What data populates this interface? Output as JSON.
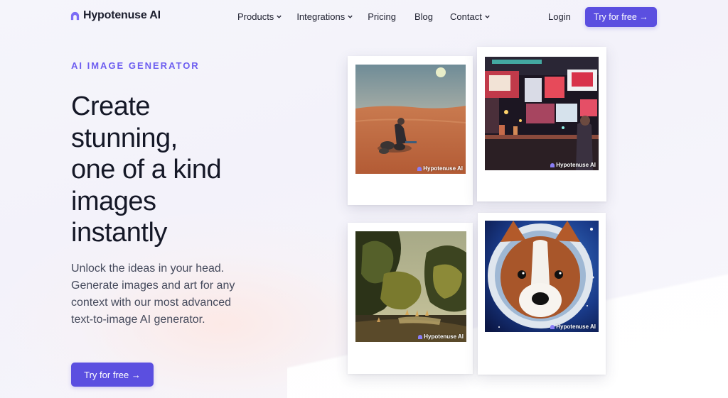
{
  "brand": {
    "name": "Hypotenuse AI",
    "accent": "#5b4fe0"
  },
  "nav": {
    "items": [
      {
        "label": "Products",
        "has_dropdown": true
      },
      {
        "label": "Integrations",
        "has_dropdown": true
      },
      {
        "label": "Pricing",
        "has_dropdown": false
      },
      {
        "label": "Blog",
        "has_dropdown": false
      },
      {
        "label": "Contact",
        "has_dropdown": true
      }
    ],
    "login_label": "Login",
    "cta_label": "Try for free →"
  },
  "hero": {
    "eyebrow": "AI IMAGE GENERATOR",
    "headline_lines": [
      "Create",
      "stunning,",
      "one of a kind",
      "images",
      "instantly"
    ],
    "subtext": "Unlock the ideas in your head. Generate images and art for any context with our most advanced text-to-image AI generator.",
    "cta_label": "Try for free →"
  },
  "gallery": {
    "watermark": "Hypotenuse AI",
    "images": [
      {
        "subject": "desert-figure"
      },
      {
        "subject": "neon-bar"
      },
      {
        "subject": "forest-deer"
      },
      {
        "subject": "corgi-astronaut"
      }
    ]
  }
}
